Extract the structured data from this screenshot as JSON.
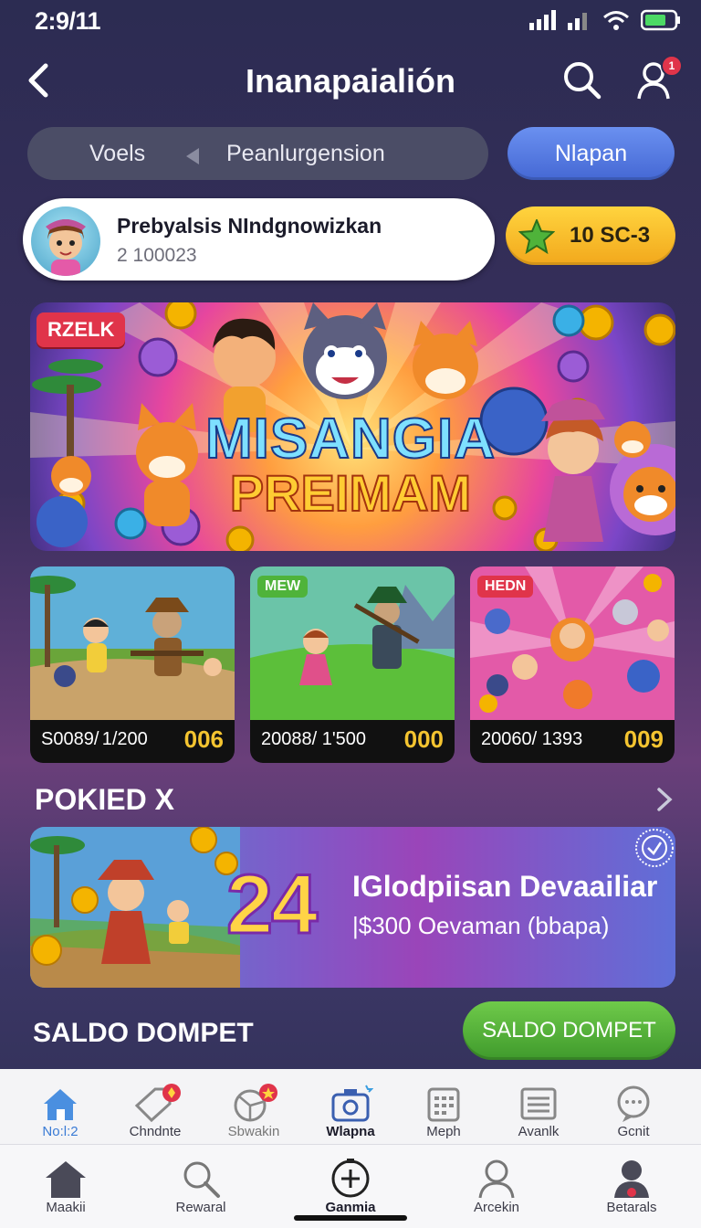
{
  "status": {
    "time": "2:9⁠/11"
  },
  "header": {
    "title": "Inanapaialión"
  },
  "segment": {
    "left": "Voels",
    "right": "Peanlurgension",
    "button": "Nlapan"
  },
  "user": {
    "name": "Prebyalsis NIndgnowizkan",
    "id": "2 100023",
    "coins": "10 SC-3",
    "notifications": "1"
  },
  "hero": {
    "badge": "RZELK",
    "title_line1": "MISANGIA",
    "title_line2": "PREIMAM"
  },
  "cards": [
    {
      "badge": "",
      "text": "S0089/ 1/200",
      "count": "006"
    },
    {
      "badge": "MEW",
      "text": "20088/ 1'500",
      "count": "000"
    },
    {
      "badge": "HEDN",
      "text": "20060/ 1393",
      "count": "009"
    }
  ],
  "section": {
    "title": "POKIED X"
  },
  "promo": {
    "number": "24",
    "title": "IGlodpiisan Devaailiar",
    "subtitle": "|$300 Oevaman  (bbapa)"
  },
  "wallet": {
    "title": "SALDO DOMPET",
    "button": "SALDO DOMPET"
  },
  "nav_top": [
    {
      "label": "No:l:2",
      "icon": "home-icon"
    },
    {
      "label": "Chndnte",
      "icon": "tag-icon"
    },
    {
      "label": "Sbwakin",
      "icon": "wheel-icon"
    },
    {
      "label": "Wlapna",
      "icon": "camera-icon"
    },
    {
      "label": "Meph",
      "icon": "calendar-icon"
    },
    {
      "label": "Avanlk",
      "icon": "list-icon"
    },
    {
      "label": "Gcnit",
      "icon": "chat-icon"
    }
  ],
  "nav_bottom": [
    {
      "label": "Maakii",
      "icon": "home-icon"
    },
    {
      "label": "Rewaral",
      "icon": "search-icon"
    },
    {
      "label": "Ganmia",
      "icon": "add-circle-icon"
    },
    {
      "label": "Arcekin",
      "icon": "person-icon"
    },
    {
      "label": "Betarals",
      "icon": "person-badge-icon"
    }
  ],
  "colors": {
    "accent_blue": "#4568d4",
    "coin_yellow": "#f2a81c",
    "green_button": "#3f9a2c",
    "badge_red": "#e0344a",
    "count_gold": "#f4c430"
  }
}
